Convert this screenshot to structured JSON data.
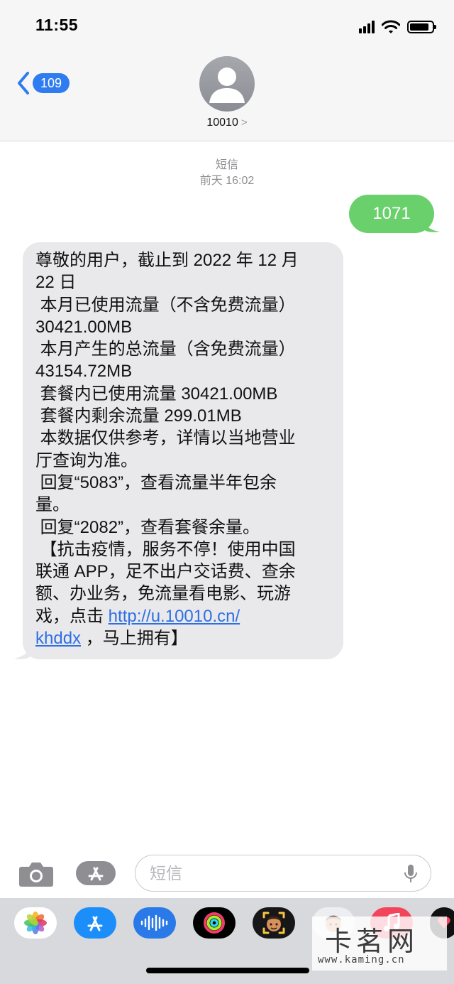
{
  "status_bar": {
    "time": "11:55",
    "battery_level": 0.85
  },
  "nav": {
    "back_count": "109",
    "contact_name": "10010",
    "contact_chevron": ">"
  },
  "conversation": {
    "service_label": "短信",
    "timestamp": "前天 16:02"
  },
  "outgoing_message": {
    "text": "1071",
    "color": "#6ad06c"
  },
  "incoming_message": {
    "lines": [
      "尊敬的用户，截止到 2022 年 12 月",
      "22 日",
      " 本月已使用流量（不含免费流量）",
      "30421.00MB",
      " 本月产生的总流量（含免费流量）",
      "43154.72MB",
      " 套餐内已使用流量 30421.00MB",
      " 套餐内剩余流量 299.01MB",
      " 本数据仅供参考，详情以当地营业",
      "厅查询为准。",
      " 回复“5083”，查看流量半年包余",
      "量。",
      " 回复“2082”，查看套餐余量。",
      " 【抗击疫情，服务不停！使用中国",
      "联通 APP，足不出户交话费、查余",
      "额、办业务，免流量看电影、玩游",
      "戏，点击 "
    ],
    "link_part1": "http://u.10010.cn/",
    "link_part2": "khddx",
    "tail_text": " ，马上拥有】",
    "link_color": "#2f6fe4"
  },
  "composer": {
    "placeholder": "短信",
    "camera_icon": "camera-icon",
    "apps_icon": "app-store-icon",
    "mic_icon": "microphone-icon"
  },
  "app_tray": {
    "icons": [
      "photos-icon",
      "app-store-icon",
      "audio-message-icon",
      "activity-icon",
      "memoji-icon",
      "memoji-stickers-icon",
      "music-icon",
      "more-apps-icon"
    ]
  },
  "watermark": {
    "main": "卡茗网",
    "sub": "www.kaming.cn"
  }
}
